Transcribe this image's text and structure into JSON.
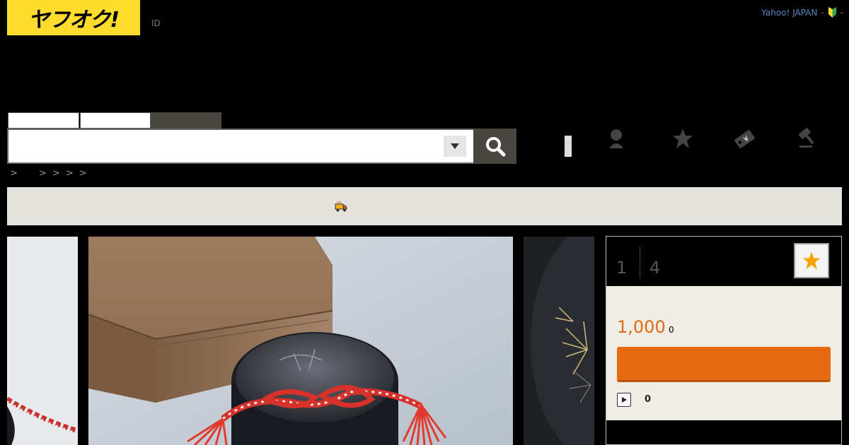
{
  "header": {
    "logo_text": "ヤフオク!",
    "login_id": "ID",
    "yahoo_link": "Yahoo! JAPAN",
    "separator": "-",
    "beginner_icon": "beginner-leaf-icon"
  },
  "search": {
    "tabs": [
      "",
      "",
      ""
    ],
    "input_value": "",
    "placeholder": "",
    "dropdown_icon": "caret-down-icon",
    "button_icon": "search-icon"
  },
  "header_nav": {
    "icons": [
      "user-icon",
      "star-icon",
      "coupon-tag-icon",
      "auction-gavel-icon"
    ]
  },
  "breadcrumb": {
    "separators": [
      ">",
      ">",
      ">",
      ">",
      ">"
    ]
  },
  "notice": {
    "icon": "shipping-truck-icon"
  },
  "gallery": {
    "images": [
      "item-photo-left",
      "item-photo-main",
      "item-photo-right"
    ]
  },
  "auction": {
    "stat_a": "1",
    "stat_b": "4",
    "price": "1,000",
    "price_suffix": "0",
    "bid_label": "",
    "play_count": "0",
    "watch_icon": "star-icon"
  },
  "colors": {
    "logo_yellow": "#fedc2e",
    "accent_orange": "#e86a10",
    "price_orange": "#e06b10",
    "link_blue": "#5a86c4",
    "panel_bg": "#efede6",
    "notice_bg": "#e3e2dd"
  }
}
